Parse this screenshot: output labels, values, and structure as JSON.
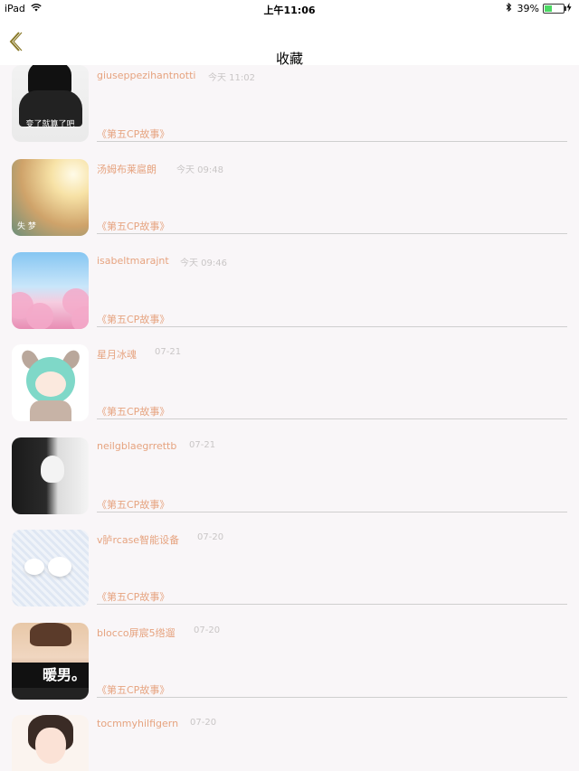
{
  "status_bar": {
    "device": "iPad",
    "time": "上午11:06",
    "battery": "39%"
  },
  "nav": {
    "title": "收藏"
  },
  "favorites": [
    {
      "name": "giuseppezihantnotti",
      "time": "今天 11:02",
      "tag": "《第五CP故事》",
      "avatar_text": "变了就算了吧"
    },
    {
      "name": "汤姆布莱扈朗",
      "time": "今天 09:48",
      "tag": "《第五CP故事》",
      "avatar_text": "失 梦"
    },
    {
      "name": "isabeltmarajnt",
      "time": "今天 09:46",
      "tag": "《第五CP故事》"
    },
    {
      "name": "星月冰魂",
      "time": "07-21",
      "tag": "《第五CP故事》"
    },
    {
      "name": "neilgblaegrrettb",
      "time": "07-21",
      "tag": "《第五CP故事》"
    },
    {
      "name": "v胪rcase智能设备",
      "time": "07-20",
      "tag": "《第五CP故事》"
    },
    {
      "name": "blocco屏宸5绺遛",
      "time": "07-20",
      "tag": "《第五CP故事》",
      "avatar_text": "暖男。"
    },
    {
      "name": "tocmmyhilfigern",
      "time": "07-20",
      "tag": ""
    }
  ]
}
